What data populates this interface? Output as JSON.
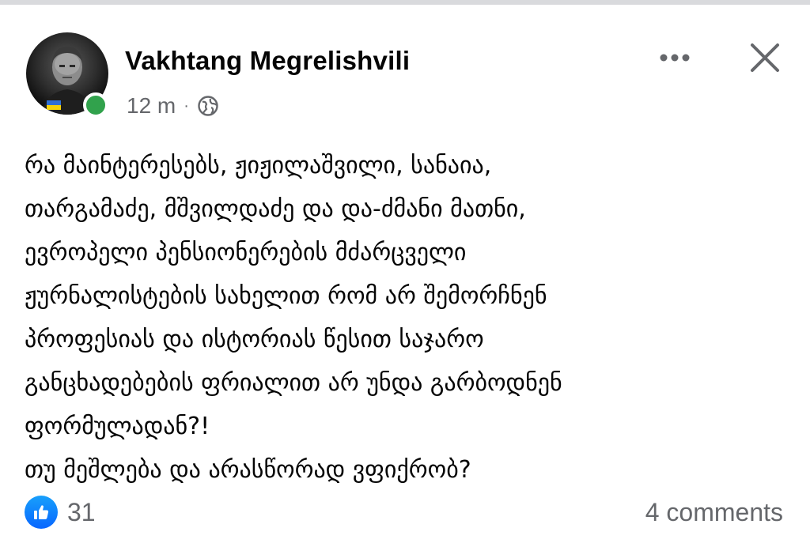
{
  "post": {
    "author_name": "Vakhtang Megrelishvili",
    "time": "12 m",
    "separator": "·",
    "privacy_icon": "globe-icon",
    "online_status_color": "#31a24c",
    "body_lines": [
      "რა მაინტერესებს, ჟიჟილაშვილი, სანაია,",
      "თარგამაძე, მშვილდაძე და და-ძმანი მათნი,",
      "ევროპელი პენსიონერების მძარცველი",
      "ჟურნალისტების სახელით რომ არ შემორჩნენ",
      "პროფესიას და ისტორიას წესით საჯარო",
      "განცხადებების ფრიალით არ უნდა გარბოდნენ",
      "ფორმულადან?!",
      "თუ მეშლება და არასწორად ვფიქრობ?"
    ],
    "reaction_icon": "like-icon",
    "reaction_count": "31",
    "comments_label": "4 comments",
    "accent_color": "#0866ff"
  },
  "header_actions": {
    "more_icon": "more-icon",
    "close_icon": "close-icon"
  }
}
